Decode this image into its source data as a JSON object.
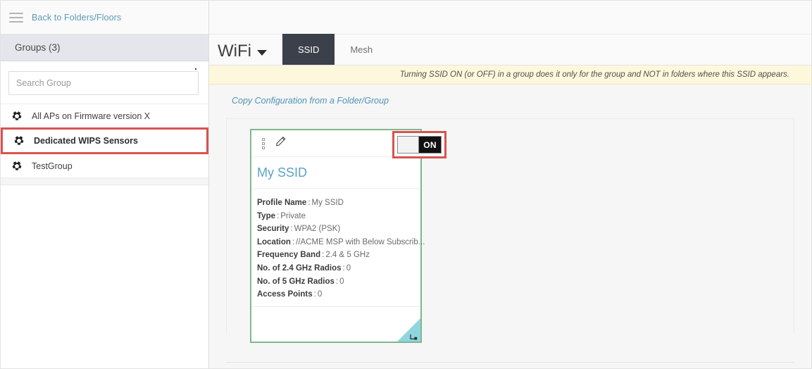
{
  "sidebar": {
    "menu_icon": "hamburger-icon",
    "back_link": "Back to Folders/Floors",
    "groups_header": "Groups (3)",
    "search": {
      "placeholder": "Search Group",
      "value": ""
    },
    "items": [
      {
        "label": "All APs on Firmware version X",
        "icon": "cluster-icon",
        "selected": false
      },
      {
        "label": "Dedicated WIPS Sensors",
        "icon": "cluster-icon",
        "selected": true
      },
      {
        "label": "TestGroup",
        "icon": "cluster-icon",
        "selected": false
      }
    ]
  },
  "main": {
    "title": "WiFi",
    "title_caret": "chevron-down-icon",
    "tabs": [
      {
        "label": "SSID",
        "active": true
      },
      {
        "label": "Mesh",
        "active": false
      }
    ],
    "notice": "Turning SSID ON (or OFF) in a group does it only for the group and NOT in folders where this SSID appears.",
    "copy_link": "Copy Configuration from a Folder/Group"
  },
  "card": {
    "kebab_icon": "kebab-menu-icon",
    "edit_icon": "pencil-icon",
    "toggle": {
      "state_label": "ON",
      "enabled": true
    },
    "title": "My SSID",
    "details": [
      {
        "key": "Profile Name",
        "value": "My SSID"
      },
      {
        "key": "Type",
        "value": "Private"
      },
      {
        "key": "Security",
        "value": "WPA2 (PSK)"
      },
      {
        "key": "Location",
        "value": "//ACME MSP with Below Subscrib..."
      },
      {
        "key": "Frequency Band",
        "value": "2.4 & 5 GHz"
      },
      {
        "key": "No. of 2.4 GHz Radios",
        "value": "0"
      },
      {
        "key": "No. of 5 GHz Radios",
        "value": "0"
      },
      {
        "key": "Access Points",
        "value": "0"
      }
    ],
    "separator": ":",
    "corner_icon": "resize-corner-icon"
  },
  "colors": {
    "accent_blue": "#5ba3c4",
    "highlight_red": "#d9534f",
    "card_border_green": "#7fb78e",
    "tab_active_bg": "#3c404b",
    "notice_bg": "#fdf8dc",
    "corner_teal": "#8fd6e0"
  }
}
